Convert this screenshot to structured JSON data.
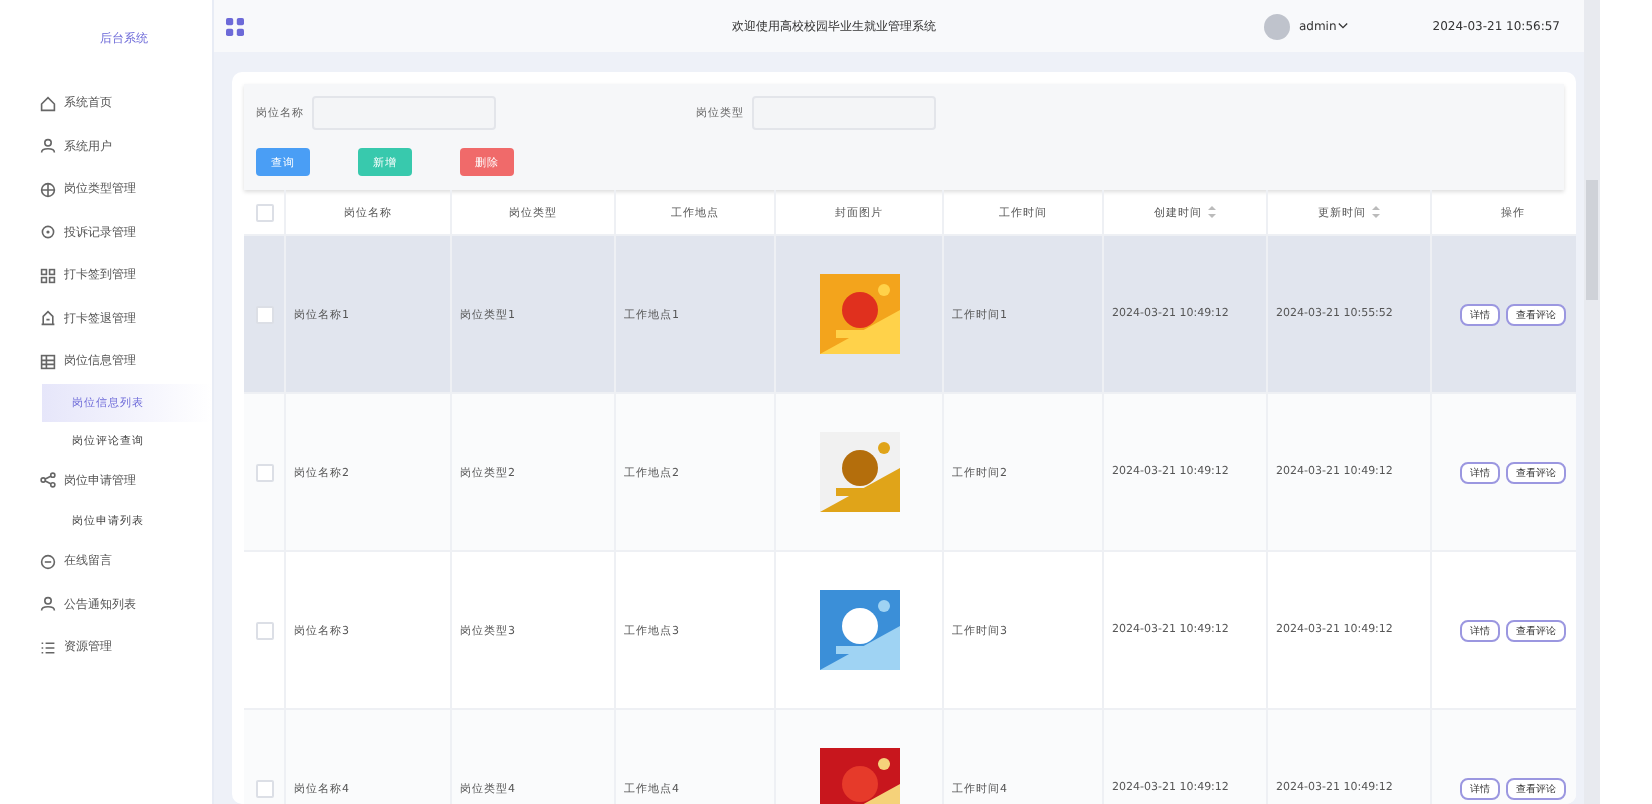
{
  "sidebar": {
    "brand": "后台系统",
    "items": [
      {
        "label": "系统首页",
        "selected": false
      },
      {
        "label": "系统用户",
        "selected": false
      },
      {
        "label": "岗位类型管理",
        "selected": false
      },
      {
        "label": "投诉记录管理",
        "selected": false
      },
      {
        "label": "打卡签到管理",
        "selected": false
      },
      {
        "label": "打卡签退管理",
        "selected": false
      },
      {
        "label": "岗位信息管理",
        "selected": false,
        "children": [
          {
            "label": "岗位信息列表",
            "selected": true
          },
          {
            "label": "岗位评论查询",
            "selected": false
          }
        ]
      },
      {
        "label": "岗位申请管理",
        "selected": false,
        "children": [
          {
            "label": "岗位申请列表",
            "selected": false
          }
        ]
      },
      {
        "label": "在线留言",
        "selected": false
      },
      {
        "label": "公告通知列表",
        "selected": false
      },
      {
        "label": "资源管理",
        "selected": false
      }
    ]
  },
  "header": {
    "title": "欢迎使用高校校园毕业生就业管理系统",
    "user": "admin",
    "datetime": "2024-03-21 10:56:57"
  },
  "filters": [
    {
      "label": "岗位名称"
    },
    {
      "label": "岗位类型"
    }
  ],
  "buttons": [
    {
      "kind": "query",
      "label": "查询"
    },
    {
      "kind": "add",
      "label": "新增"
    },
    {
      "kind": "delete",
      "label": "删除"
    }
  ],
  "table": {
    "all_checked": false,
    "columns": [
      {
        "label": "岗位名称",
        "sortable": false
      },
      {
        "label": "岗位类型",
        "sortable": false
      },
      {
        "label": "工作地点",
        "sortable": false
      },
      {
        "label": "封面图片",
        "sortable": false
      },
      {
        "label": "工作时间",
        "sortable": false
      },
      {
        "label": "创建时间",
        "sortable": true
      },
      {
        "label": "更新时间",
        "sortable": true
      },
      {
        "label": "操作",
        "sortable": false
      }
    ],
    "rows": [
      {
        "hovered": true,
        "checked": false,
        "cells": [
          "岗位名称1",
          "岗位类型1",
          "工作地点1",
          {
            "kind": "picture"
          },
          "工作时间1",
          "2024-03-21 10:49:12",
          "2024-03-21 10:55:52",
          [
            "详情",
            "查看评论"
          ]
        ]
      },
      {
        "hovered": false,
        "checked": false,
        "cells": [
          "岗位名称2",
          "岗位类型2",
          "工作地点2",
          {
            "kind": "picture"
          },
          "工作时间2",
          "2024-03-21 10:49:12",
          "2024-03-21 10:49:12",
          [
            "详情",
            "查看评论"
          ]
        ]
      },
      {
        "hovered": false,
        "checked": false,
        "cells": [
          "岗位名称3",
          "岗位类型3",
          "工作地点3",
          {
            "kind": "picture"
          },
          "工作时间3",
          "2024-03-21 10:49:12",
          "2024-03-21 10:49:12",
          [
            "详情",
            "查看评论"
          ]
        ]
      },
      {
        "hovered": false,
        "checked": false,
        "cells": [
          "岗位名称4",
          "岗位类型4",
          "工作地点4",
          {
            "kind": "picture"
          },
          "工作时间4",
          "2024-03-21 10:49:12",
          "2024-03-21 10:49:12",
          [
            "详情",
            "查看评论"
          ]
        ]
      }
    ]
  }
}
